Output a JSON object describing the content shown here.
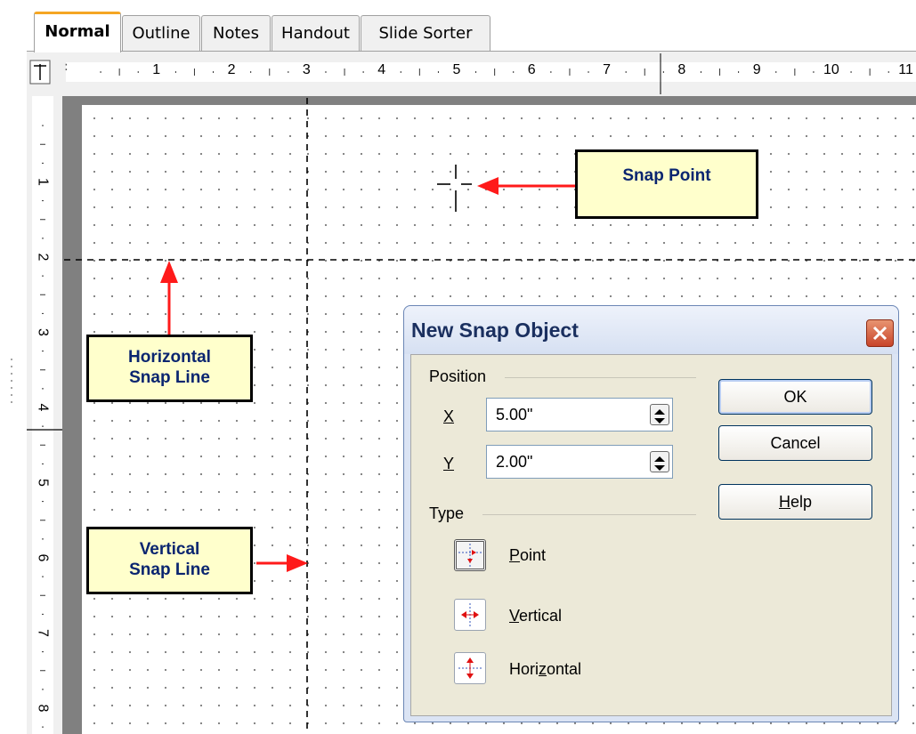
{
  "tabs": [
    {
      "label": "Normal",
      "active": true
    },
    {
      "label": "Outline",
      "active": false
    },
    {
      "label": "Notes",
      "active": false
    },
    {
      "label": "Handout",
      "active": false
    },
    {
      "label": "Slide Sorter",
      "active": false
    }
  ],
  "ruler": {
    "horizontal_numbers": [
      "1",
      "2",
      "3",
      "4",
      "5",
      "6",
      "7",
      "8",
      "9",
      "10",
      "11"
    ],
    "vertical_numbers": [
      "1",
      "2",
      "3",
      "4",
      "5",
      "6",
      "7",
      "8"
    ]
  },
  "callouts": {
    "snap_point": "Snap Point",
    "horizontal_line_1": "Horizontal",
    "horizontal_line_2": "Snap Line",
    "vertical_line_1": "Vertical",
    "vertical_line_2": "Snap Line"
  },
  "colors": {
    "arrow": "#ff1a1a",
    "callout_fill": "#ffffcc",
    "callout_text": "#0a2570",
    "active_tab_accent": "#f5a623"
  },
  "dialog": {
    "title": "New Snap Object",
    "position_label": "Position",
    "x_label": "X",
    "x_value": "5.00\"",
    "y_label": "Y",
    "y_value": "2.00\"",
    "type_label": "Type",
    "types": [
      {
        "prefix": "",
        "underline": "P",
        "rest": "oint",
        "icon": "snap-point-icon",
        "selected": true
      },
      {
        "prefix": "",
        "underline": "V",
        "rest": "ertical",
        "icon": "snap-vertical-icon",
        "selected": false
      },
      {
        "prefix": "Hori",
        "underline": "z",
        "rest": "ontal",
        "icon": "snap-horizontal-icon",
        "selected": false
      }
    ],
    "ok_label": "OK",
    "cancel_label": "Cancel",
    "help_underline": "H",
    "help_rest": "elp"
  }
}
